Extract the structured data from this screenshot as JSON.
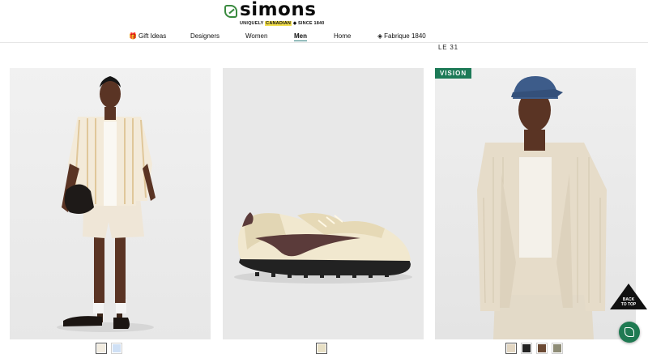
{
  "brand": {
    "name": "simons",
    "tagline_pre": "UNIQUELY ",
    "tagline_highlight": "CANADIAN",
    "tagline_post": " ◆ SINCE 1840"
  },
  "nav": {
    "items": [
      {
        "label": "Gift Ideas",
        "icon": "gift-icon"
      },
      {
        "label": "Designers"
      },
      {
        "label": "Women"
      },
      {
        "label": "Men",
        "active": true
      },
      {
        "label": "Home"
      },
      {
        "label": "Fabrique 1840",
        "icon": "leaf-icon"
      }
    ]
  },
  "collection_label": "LE 31",
  "products": [
    {
      "swatches": [
        "#f2ece0",
        "#cfe0f5"
      ],
      "selected": 0
    },
    {
      "swatches": [
        "#e7dfc4"
      ],
      "selected": 0
    },
    {
      "badge": "VISION",
      "swatches": [
        "#e2d6c2",
        "#232323",
        "#6b4a34",
        "#8e8c76"
      ],
      "selected": 0
    }
  ],
  "back_to_top": {
    "line1": "BACK",
    "line2": "TO TOP"
  },
  "colors": {
    "accent": "#1d7a57",
    "nav_underline": "#2c7c7c",
    "highlight": "#f4e04d"
  }
}
